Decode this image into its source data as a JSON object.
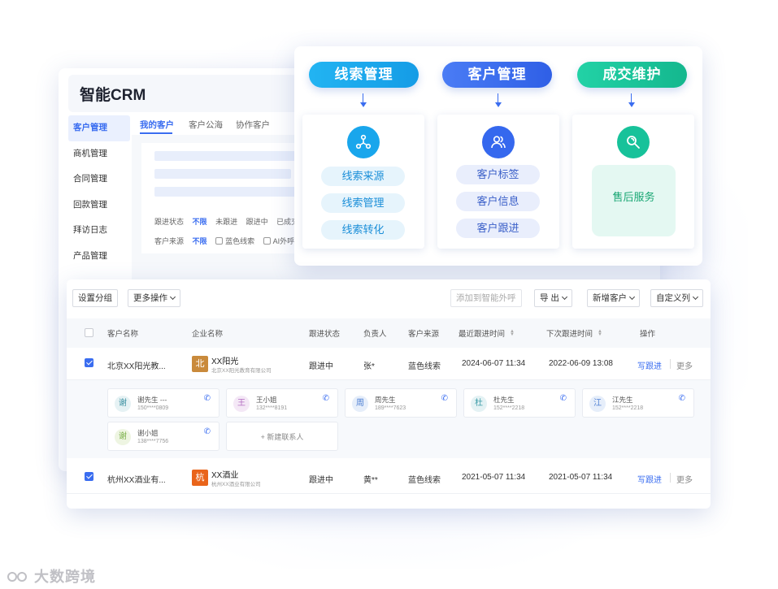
{
  "back_window": {
    "title": "智能CRM",
    "sidebar": [
      "客户管理",
      "商机管理",
      "合同管理",
      "回款管理",
      "拜访日志",
      "产品管理"
    ],
    "tabs": [
      "我的客户",
      "客户公海",
      "协作客户"
    ],
    "filters": {
      "status_label": "跟进状态",
      "status_options": [
        "不限",
        "未跟进",
        "跟进中",
        "已成交"
      ],
      "source_label": "客户来源",
      "source_selected": "不限",
      "source_checks": [
        "蓝色线索",
        "AI外呼"
      ]
    }
  },
  "modules": [
    {
      "title": "线索管理",
      "color": "#19a6ec",
      "icon": "share-nodes-icon",
      "items": [
        "线索来源",
        "线索管理",
        "线索转化"
      ]
    },
    {
      "title": "客户管理",
      "color": "#3568ee",
      "icon": "users-icon",
      "items": [
        "客户标签",
        "客户信息",
        "客户跟进"
      ]
    },
    {
      "title": "成交维护",
      "color": "#17c29a",
      "icon": "wrench-icon",
      "items": [
        "售后服务"
      ]
    }
  ],
  "toolbar": {
    "set_group": "设置分组",
    "more_ops": "更多操作",
    "add_outbound": "添加到智能外呼",
    "export": "导 出",
    "new_customer": "新增客户",
    "custom_columns": "自定义列"
  },
  "table": {
    "headers": [
      "客户名称",
      "企业名称",
      "跟进状态",
      "负责人",
      "客户来源",
      "最近跟进时间",
      "下次跟进时间",
      "操作"
    ],
    "rows": [
      {
        "customer": "北京XX阳光教...",
        "logo_char": "北",
        "logo_color": "#c98a3c",
        "company": "XX阳光",
        "company_full": "北京XX阳光教育有限公司",
        "status": "跟进中",
        "owner": "张*",
        "source": "蓝色线索",
        "last_follow": "2024-06-07 11:34",
        "next_follow": "2022-06-09 13:08",
        "action": "写跟进",
        "more": "更多"
      },
      {
        "customer": "杭州XX酒业有...",
        "logo_char": "杭",
        "logo_color": "#e9641a",
        "company": "XX酒业",
        "company_full": "杭州XX酒业有限公司",
        "status": "跟进中",
        "owner": "黄**",
        "source": "蓝色线索",
        "last_follow": "2021-05-07 11:34",
        "next_follow": "2021-05-07 11:34",
        "action": "写跟进",
        "more": "更多"
      }
    ],
    "contacts": [
      {
        "avatar": "谢",
        "name": "谢先生 ---",
        "phone": "150****0809",
        "bg": "#e6f2f4",
        "fg": "#3a8fa0"
      },
      {
        "avatar": "王",
        "name": "王小姐",
        "phone": "132****8191",
        "bg": "#f4e8f6",
        "fg": "#b46ec2"
      },
      {
        "avatar": "周",
        "name": "周先生",
        "phone": "189****7623",
        "bg": "#e6eefa",
        "fg": "#4b7dd2"
      },
      {
        "avatar": "杜",
        "name": "杜先生",
        "phone": "152****2218",
        "bg": "#e4f2f4",
        "fg": "#3a9aa6"
      },
      {
        "avatar": "江",
        "name": "江先生",
        "phone": "152****2218",
        "bg": "#e6eefa",
        "fg": "#4b7dd2"
      },
      {
        "avatar": "谢",
        "name": "谢小姐",
        "phone": "138****7756",
        "bg": "#eef5e2",
        "fg": "#7bb04a"
      }
    ],
    "new_contact": "+ 新建联系人"
  },
  "watermark": "大数跨境"
}
